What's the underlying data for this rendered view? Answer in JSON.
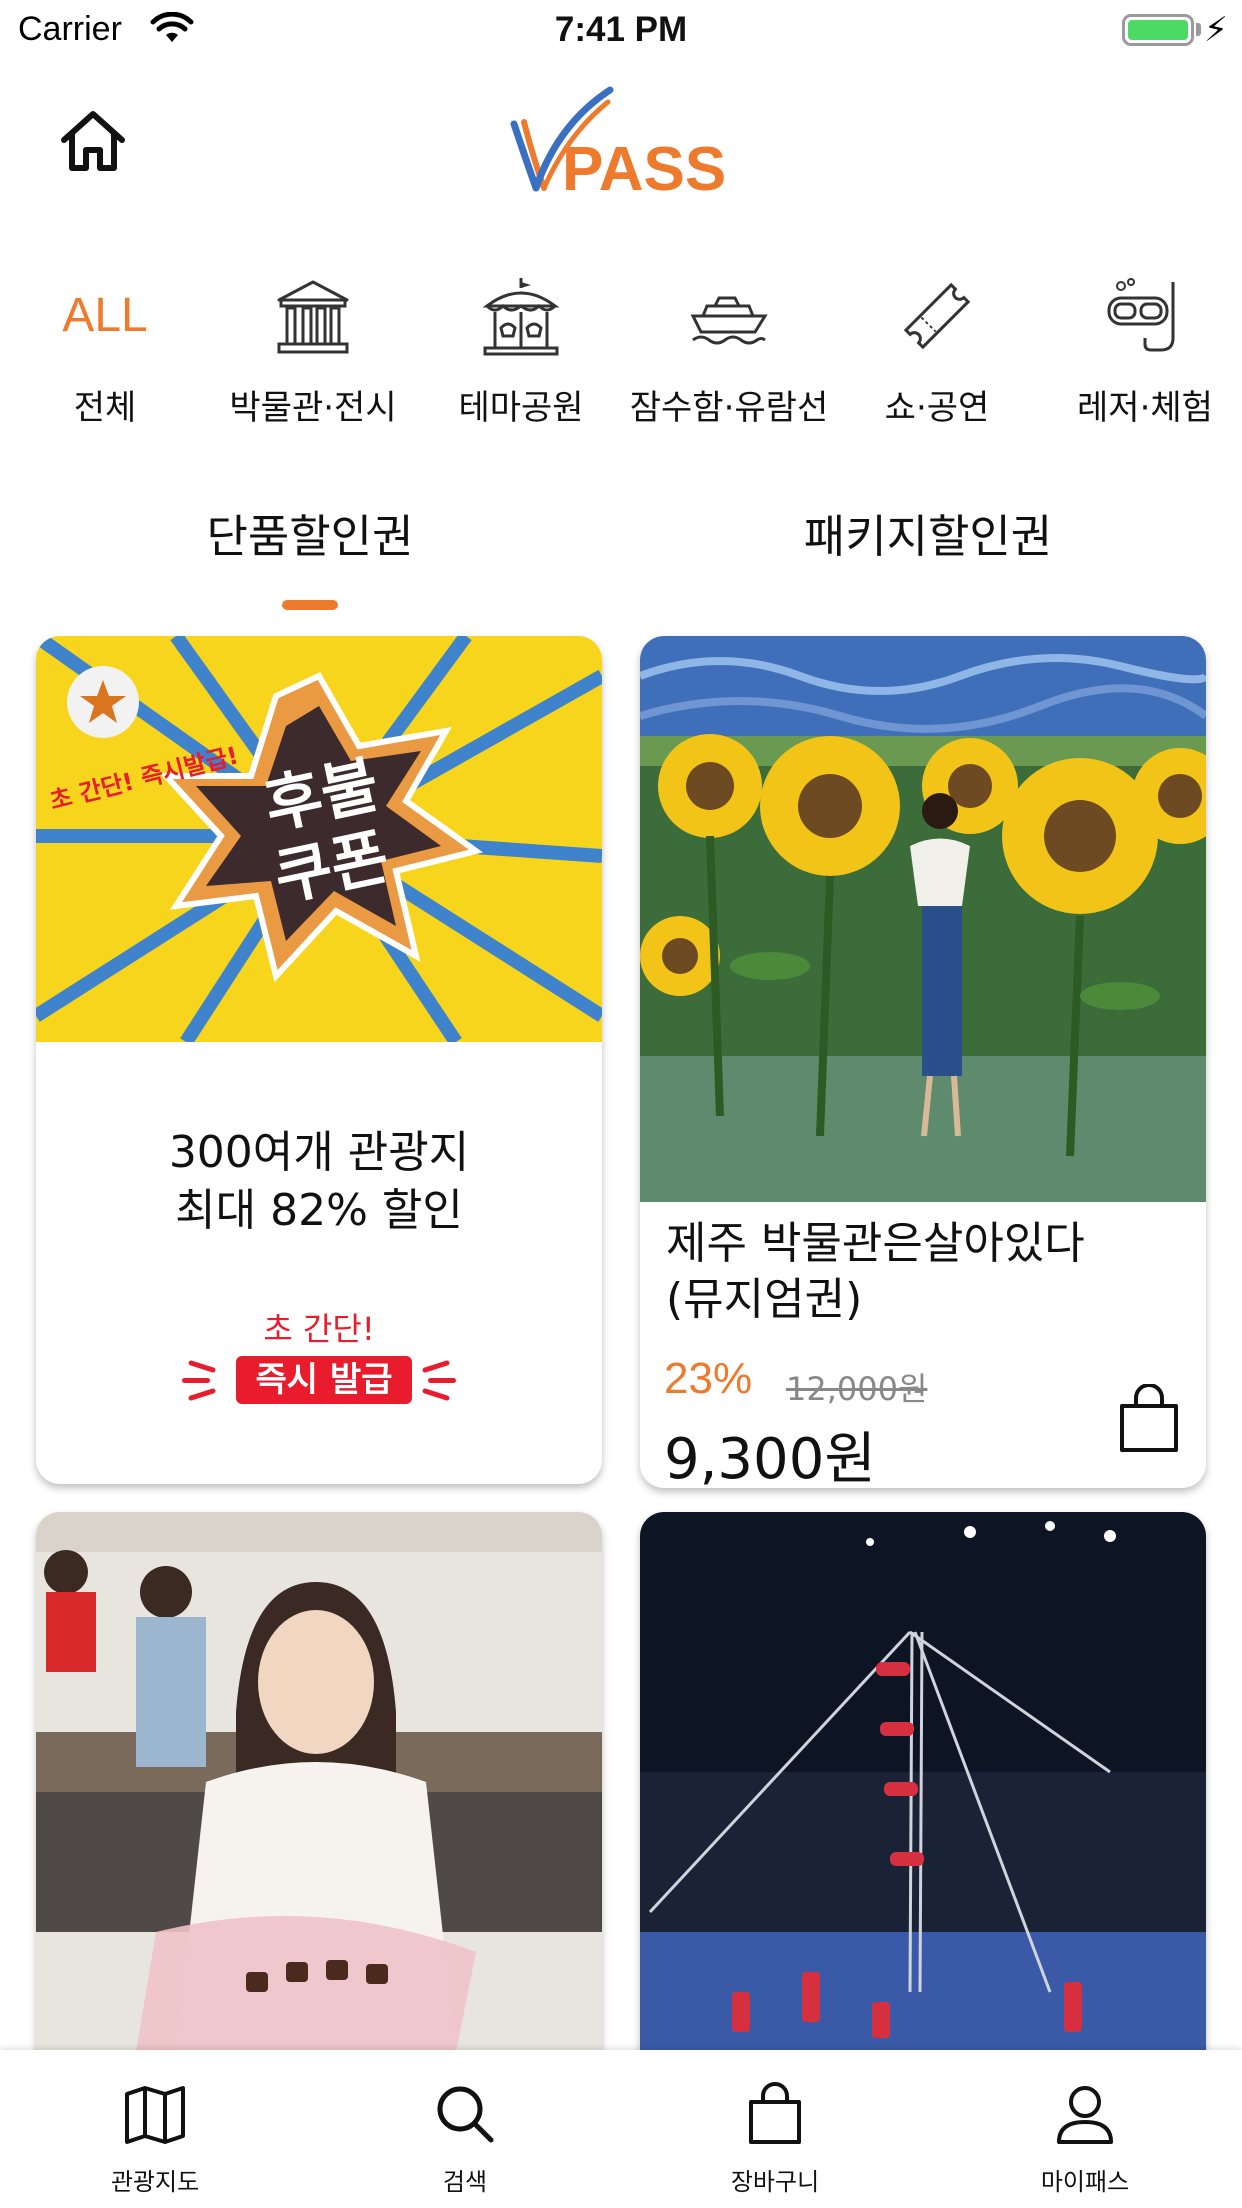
{
  "status_bar": {
    "carrier": "Carrier",
    "time": "7:41 PM"
  },
  "header": {
    "logo_text": "PASS",
    "home_icon": "home-icon"
  },
  "categories": [
    {
      "label": "전체",
      "icon_text": "ALL",
      "icon": "all-text"
    },
    {
      "label": "박물관·전시",
      "icon": "museum-icon"
    },
    {
      "label": "테마공원",
      "icon": "carousel-icon"
    },
    {
      "label": "잠수함·유람선",
      "icon": "cruise-ship-icon"
    },
    {
      "label": "쇼·공연",
      "icon": "ticket-icon"
    },
    {
      "label": "레저·체험",
      "icon": "snorkel-icon"
    }
  ],
  "tabs": [
    {
      "label": "단품할인권",
      "selected": true
    },
    {
      "label": "패키지할인권",
      "selected": false
    }
  ],
  "accent_color": "#ee7a2e",
  "cards": [
    {
      "image_text_line1": "후불",
      "image_text_line2": "쿠폰",
      "image_badge": "초 간단! 즉시발급!",
      "line1": "300여개 관광지",
      "line2": "최대 82% 할인",
      "sub": "초 간단!",
      "pill": "즉시 발급"
    },
    {
      "title_line1": "제주 박물관은살아있다",
      "title_line2": "(뮤지엄권)",
      "discount": "23%",
      "original_price": "12,000원",
      "price": "9,300원"
    }
  ],
  "bottom_nav": [
    {
      "label": "관광지도",
      "icon": "map-icon"
    },
    {
      "label": "검색",
      "icon": "search-icon"
    },
    {
      "label": "장바구니",
      "icon": "shopping-bag-icon"
    },
    {
      "label": "마이패스",
      "icon": "user-icon"
    }
  ]
}
